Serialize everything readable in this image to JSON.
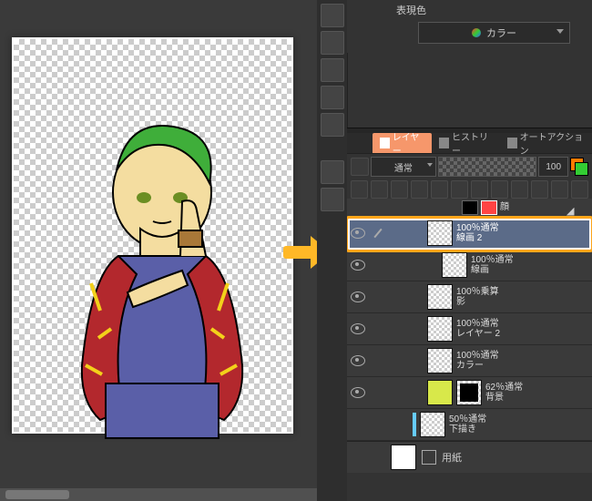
{
  "expression": {
    "label": "表現色",
    "dropdown": "カラー"
  },
  "tabs": {
    "layers": "レイヤー",
    "history": "ヒストリー",
    "autoaction": "オートアクション"
  },
  "blend": {
    "mode": "通常",
    "opacity": "100"
  },
  "toolbar_icons": [
    "layer-mode",
    "new-layer",
    "new-folder",
    "clip",
    "lock",
    "link",
    "mask",
    "effect",
    "combine",
    "delete"
  ],
  "layers": [
    {
      "mode": "",
      "name": "顔",
      "indent": 82,
      "vis": false,
      "top": true
    },
    {
      "mode": "100％通常",
      "name": "線画 2",
      "indent": 44,
      "vis": true,
      "sel": true,
      "ed": true
    },
    {
      "mode": "100％通常",
      "name": "線画",
      "indent": 60,
      "vis": true
    },
    {
      "mode": "100％乗算",
      "name": "影",
      "indent": 44,
      "vis": true
    },
    {
      "mode": "100％通常",
      "name": "レイヤー 2",
      "indent": 44,
      "vis": true
    },
    {
      "mode": "100％通常",
      "name": "カラー",
      "indent": 44,
      "vis": true
    },
    {
      "mode": "62％通常",
      "name": "背景",
      "indent": 44,
      "vis": true,
      "mask": true,
      "ext": true
    },
    {
      "mode": "50％通常",
      "name": "下描き",
      "indent": 28,
      "vis": false,
      "ext": true
    }
  ],
  "paper": {
    "label": "用紙"
  }
}
